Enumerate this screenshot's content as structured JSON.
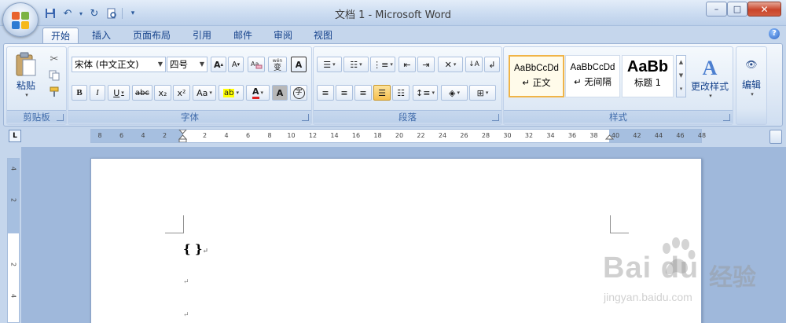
{
  "window": {
    "title": "文档 1 - Microsoft Word",
    "controls": {
      "minimize": "–",
      "maximize": "□",
      "close": "✕"
    }
  },
  "quick_access": {
    "customize_label": "▾"
  },
  "tabs": [
    {
      "label": "开始",
      "active": true
    },
    {
      "label": "插入",
      "active": false
    },
    {
      "label": "页面布局",
      "active": false
    },
    {
      "label": "引用",
      "active": false
    },
    {
      "label": "邮件",
      "active": false
    },
    {
      "label": "审阅",
      "active": false
    },
    {
      "label": "视图",
      "active": false
    }
  ],
  "help_label": "?",
  "ribbon": {
    "clipboard": {
      "label": "剪贴板",
      "paste_label": "粘贴"
    },
    "font": {
      "label": "字体",
      "font_name": "宋体 (中文正文)",
      "font_size": "四号",
      "grow_label": "A",
      "shrink_label": "A",
      "phonetic_label": "wén",
      "char_border_label": "A",
      "bold": "B",
      "italic": "I",
      "underline": "U",
      "strike": "abc",
      "subscript": "x₂",
      "superscript": "x²",
      "change_case": "Aa",
      "highlight": "ab",
      "font_color": "A",
      "shading": "A",
      "enclose": "字",
      "pinyin_char": "变"
    },
    "paragraph": {
      "label": "段落"
    },
    "styles": {
      "label": "样式",
      "tiles": [
        {
          "sample": "AaBbCcDd",
          "name": "↵ 正文",
          "selected": true
        },
        {
          "sample": "AaBbCcDd",
          "name": "↵ 无间隔",
          "selected": false
        },
        {
          "sample": "AaBb",
          "name": "标题 1",
          "selected": false
        }
      ],
      "change_styles_label": "更改样式"
    },
    "editing": {
      "label": "编辑"
    }
  },
  "ruler": {
    "corner_label": "L",
    "ticks_left": [
      "8",
      "6",
      "4",
      "2"
    ],
    "ticks_right": [
      "2",
      "4",
      "6",
      "8",
      "10",
      "12",
      "14",
      "16",
      "18",
      "20",
      "22",
      "24",
      "26",
      "28",
      "30",
      "32",
      "34",
      "36",
      "38",
      "40",
      "42",
      "44",
      "46",
      "48"
    ],
    "vticks": [
      "4",
      "2",
      "2",
      "4"
    ]
  },
  "document": {
    "line1_text": "{   }",
    "para_mark": "↵"
  },
  "watermark": {
    "brand": "Bai du",
    "cn": "经验",
    "url": "jingyan.baidu.com"
  }
}
